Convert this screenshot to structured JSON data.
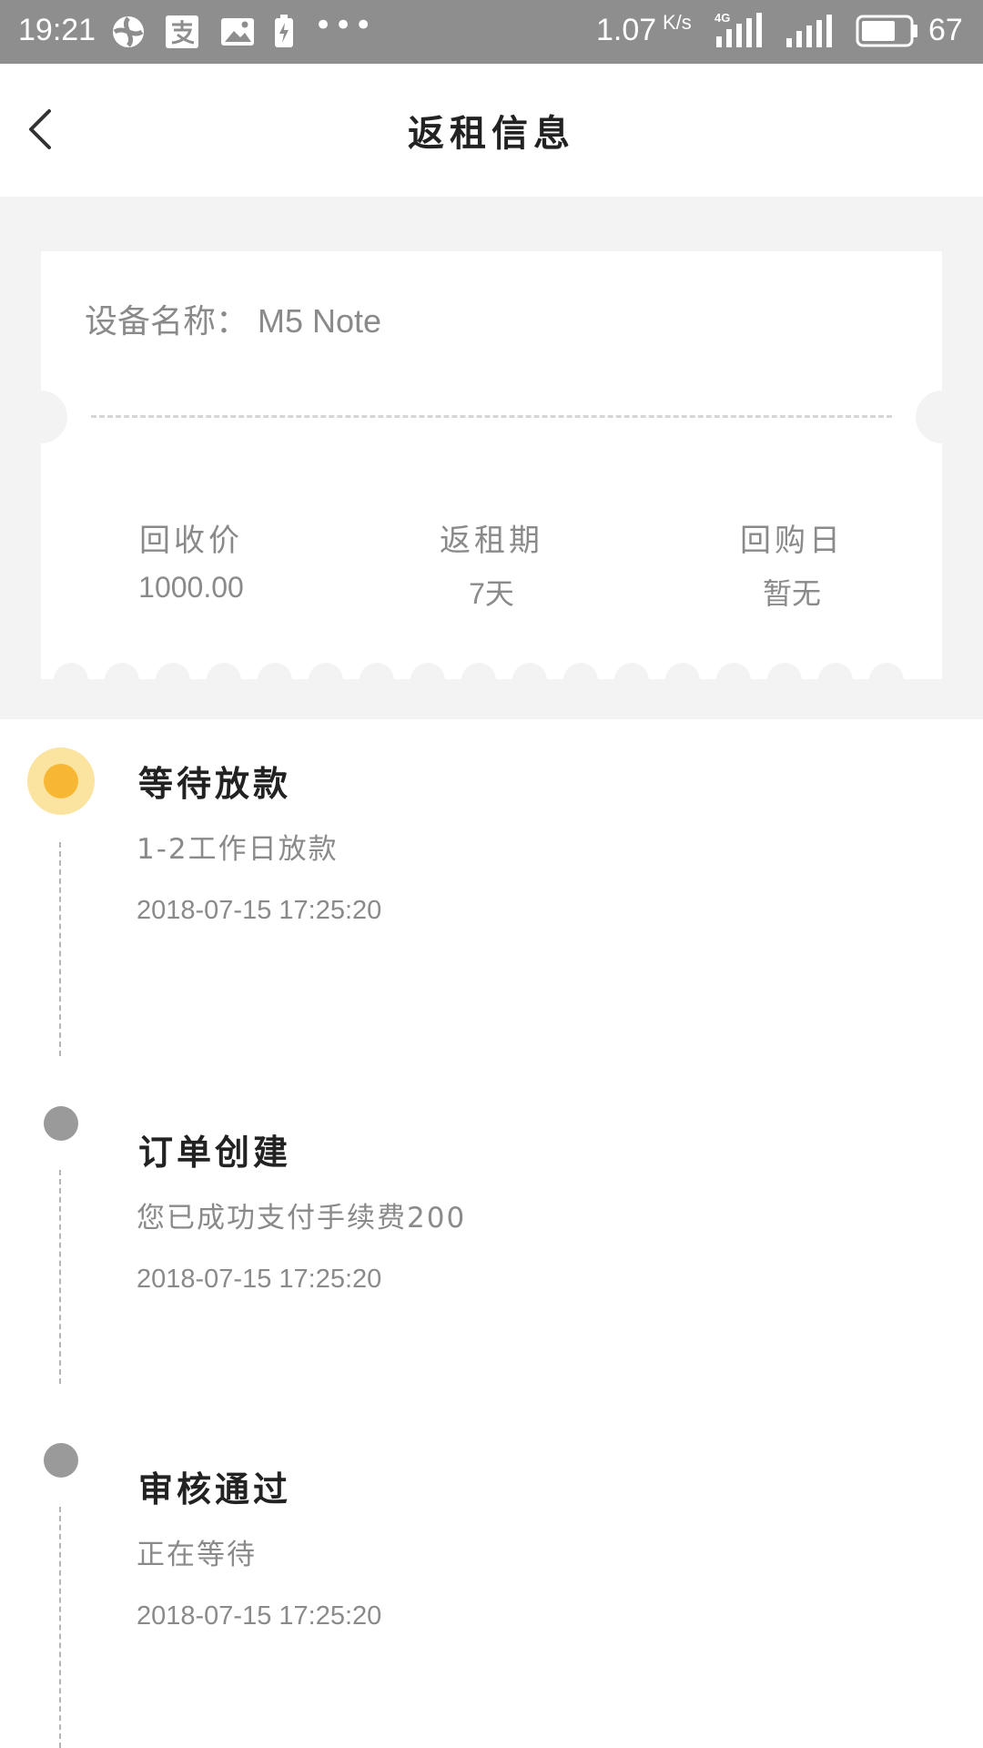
{
  "status_bar": {
    "time": "19:21",
    "icons": [
      "browser-icon",
      "alipay-icon",
      "gallery-icon",
      "battery-saver-icon"
    ],
    "more": "•••",
    "speed": "1.07",
    "speed_unit": "K/s",
    "network": "4G",
    "battery": "67"
  },
  "header": {
    "title": "返租信息",
    "back_icon": "chevron-left-icon"
  },
  "ticket": {
    "device_label": "设备名称：",
    "device_value": "M5 Note",
    "info": [
      {
        "label": "回收价",
        "value": "1000.00"
      },
      {
        "label": "返租期",
        "value": "7天"
      },
      {
        "label": "回购日",
        "value": "暂无"
      }
    ]
  },
  "timeline": [
    {
      "title": "等待放款",
      "desc": "1-2工作日放款",
      "time": "2018-07-15 17:25:20",
      "active": true
    },
    {
      "title": "订单创建",
      "desc": "您已成功支付手续费200",
      "time": "2018-07-15 17:25:20",
      "active": false
    },
    {
      "title": "审核通过",
      "desc": "正在等待",
      "time": "2018-07-15 17:25:20",
      "active": false
    }
  ],
  "colors": {
    "status_bar": "#8e8e8e",
    "page_bg": "#f3f3f3",
    "active_dot": "#f7b733",
    "active_dot_halo": "#fbe3a0",
    "inactive_dot": "#9a9a9a"
  }
}
